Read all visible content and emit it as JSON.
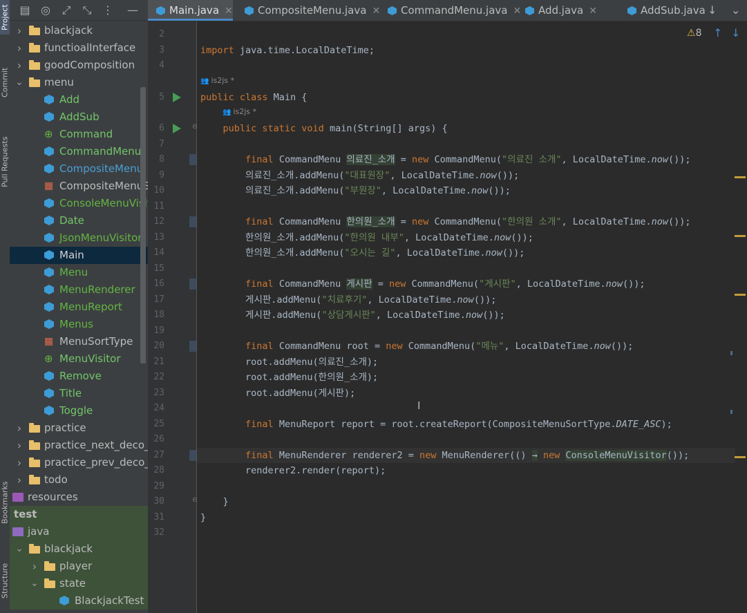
{
  "sidebar": {
    "tabs": [
      {
        "label": "Project",
        "active": true
      },
      {
        "label": "Commit",
        "active": false
      },
      {
        "label": "Pull Requests",
        "active": false
      },
      {
        "label": "Bookmarks",
        "active": false
      },
      {
        "label": "Structure",
        "active": false
      }
    ]
  },
  "project": {
    "toolbar_icons": [
      "project-files-icon",
      "target-icon",
      "expand-icon",
      "collapse-icon",
      "options-icon",
      "minimize-icon"
    ],
    "tree": [
      {
        "label": "blackjack",
        "type": "folder",
        "depth": 0,
        "expanded": false
      },
      {
        "label": "functioalInterface",
        "type": "folder",
        "depth": 0,
        "expanded": false
      },
      {
        "label": "goodComposition",
        "type": "folder",
        "depth": 0,
        "expanded": false
      },
      {
        "label": "menu",
        "type": "folder",
        "depth": 0,
        "expanded": true
      },
      {
        "label": "Add",
        "type": "class",
        "depth": 1
      },
      {
        "label": "AddSub",
        "type": "class",
        "depth": 1
      },
      {
        "label": "Command",
        "type": "interface",
        "depth": 1
      },
      {
        "label": "CommandMenu",
        "type": "class",
        "depth": 1
      },
      {
        "label": "CompositeMenu",
        "type": "class",
        "depth": 1
      },
      {
        "label": "CompositeMenuSo",
        "type": "enum",
        "depth": 1
      },
      {
        "label": "ConsoleMenuVisito",
        "type": "class",
        "depth": 1
      },
      {
        "label": "Date",
        "type": "class",
        "depth": 1
      },
      {
        "label": "JsonMenuVisitor",
        "type": "class",
        "depth": 1
      },
      {
        "label": "Main",
        "type": "class",
        "depth": 1,
        "selected": true
      },
      {
        "label": "Menu",
        "type": "class",
        "depth": 1
      },
      {
        "label": "MenuRenderer",
        "type": "class",
        "depth": 1
      },
      {
        "label": "MenuReport",
        "type": "class",
        "depth": 1
      },
      {
        "label": "Menus",
        "type": "class",
        "depth": 1
      },
      {
        "label": "MenuSortType",
        "type": "enum",
        "depth": 1
      },
      {
        "label": "MenuVisitor",
        "type": "interface",
        "depth": 1
      },
      {
        "label": "Remove",
        "type": "class",
        "depth": 1
      },
      {
        "label": "Title",
        "type": "class",
        "depth": 1
      },
      {
        "label": "Toggle",
        "type": "class",
        "depth": 1
      },
      {
        "label": "practice",
        "type": "folder",
        "depth": 0,
        "expanded": false
      },
      {
        "label": "practice_next_deco_fo",
        "type": "folder",
        "depth": 0,
        "expanded": false
      },
      {
        "label": "practice_prev_deco_fo",
        "type": "folder",
        "depth": 0,
        "expanded": false
      },
      {
        "label": "todo",
        "type": "folder",
        "depth": 0,
        "expanded": false
      },
      {
        "label": "resources",
        "type": "resources",
        "depth": -1
      },
      {
        "label": "test",
        "type": "heading",
        "depth": -2
      },
      {
        "label": "java",
        "type": "javasrc",
        "depth": -1
      },
      {
        "label": "blackjack",
        "type": "folder",
        "depth": 0,
        "expanded": true
      },
      {
        "label": "player",
        "type": "folder",
        "depth": 1,
        "expanded": false
      },
      {
        "label": "state",
        "type": "folder",
        "depth": 1,
        "expanded": true
      },
      {
        "label": "BlackjackTest",
        "type": "class",
        "depth": 2
      }
    ]
  },
  "tabs": [
    {
      "label": "Main.java",
      "active": true,
      "closable": true
    },
    {
      "label": "CompositeMenu.java",
      "active": false,
      "closable": true
    },
    {
      "label": "CommandMenu.java",
      "active": false,
      "closable": true
    },
    {
      "label": "Add.java",
      "active": false,
      "closable": true
    },
    {
      "label": "AddSub.java",
      "active": false,
      "closable": true
    }
  ],
  "inspections": {
    "warnings": "8"
  },
  "editor": {
    "current_line": 27,
    "hints": [
      {
        "before_line": 5,
        "text": "is2js *"
      },
      {
        "before_line": 6,
        "text": "is2js *"
      }
    ],
    "run_lines": [
      5,
      6
    ],
    "lines": [
      {
        "n": 2,
        "segments": []
      },
      {
        "n": 3,
        "segments": [
          [
            "kw",
            "import "
          ],
          [
            "pl",
            "java.time.LocalDateTime;"
          ]
        ]
      },
      {
        "n": 4,
        "segments": []
      },
      {
        "n": 5,
        "segments": [
          [
            "kw",
            "public class "
          ],
          [
            "pl",
            "Main {"
          ]
        ]
      },
      {
        "n": 6,
        "segments": [
          [
            "pl",
            "    "
          ],
          [
            "kw",
            "public static void "
          ],
          [
            "pl",
            "main(String[] args) {"
          ]
        ]
      },
      {
        "n": 7,
        "segments": []
      },
      {
        "n": 8,
        "segments": [
          [
            "pl",
            "        "
          ],
          [
            "kw",
            "final "
          ],
          [
            "pl",
            "CommandMenu "
          ],
          [
            "var",
            "의료진_소개"
          ],
          [
            "pl",
            " = "
          ],
          [
            "kw",
            "new "
          ],
          [
            "pl",
            "CommandMenu("
          ],
          [
            "str",
            "\"의료진 소개\""
          ],
          [
            "pl",
            ", LocalDateTime."
          ],
          [
            "it",
            "now"
          ],
          [
            "pl",
            "());"
          ]
        ]
      },
      {
        "n": 9,
        "segments": [
          [
            "pl",
            "        의료진_소개.addMenu("
          ],
          [
            "str",
            "\"대표원장\""
          ],
          [
            "pl",
            ", LocalDateTime."
          ],
          [
            "it",
            "now"
          ],
          [
            "pl",
            "());"
          ]
        ]
      },
      {
        "n": 10,
        "segments": [
          [
            "pl",
            "        의료진_소개.addMenu("
          ],
          [
            "str",
            "\"부원장\""
          ],
          [
            "pl",
            ", LocalDateTime."
          ],
          [
            "it",
            "now"
          ],
          [
            "pl",
            "());"
          ]
        ]
      },
      {
        "n": 11,
        "segments": []
      },
      {
        "n": 12,
        "segments": [
          [
            "pl",
            "        "
          ],
          [
            "kw",
            "final "
          ],
          [
            "pl",
            "CommandMenu "
          ],
          [
            "var",
            "한의원_소개"
          ],
          [
            "pl",
            " = "
          ],
          [
            "kw",
            "new "
          ],
          [
            "pl",
            "CommandMenu("
          ],
          [
            "str",
            "\"한의원 소개\""
          ],
          [
            "pl",
            ", LocalDateTime."
          ],
          [
            "it",
            "now"
          ],
          [
            "pl",
            "());"
          ]
        ]
      },
      {
        "n": 13,
        "segments": [
          [
            "pl",
            "        한의원_소개.addMenu("
          ],
          [
            "str",
            "\"한의원 내부\""
          ],
          [
            "pl",
            ", LocalDateTime."
          ],
          [
            "it",
            "now"
          ],
          [
            "pl",
            "());"
          ]
        ]
      },
      {
        "n": 14,
        "segments": [
          [
            "pl",
            "        한의원_소개.addMenu("
          ],
          [
            "str",
            "\"오시는 길\""
          ],
          [
            "pl",
            ", LocalDateTime."
          ],
          [
            "it",
            "now"
          ],
          [
            "pl",
            "());"
          ]
        ]
      },
      {
        "n": 15,
        "segments": []
      },
      {
        "n": 16,
        "segments": [
          [
            "pl",
            "        "
          ],
          [
            "kw",
            "final "
          ],
          [
            "pl",
            "CommandMenu "
          ],
          [
            "var",
            "게시판"
          ],
          [
            "pl",
            " = "
          ],
          [
            "kw",
            "new "
          ],
          [
            "pl",
            "CommandMenu("
          ],
          [
            "str",
            "\"게시판\""
          ],
          [
            "pl",
            ", LocalDateTime."
          ],
          [
            "it",
            "now"
          ],
          [
            "pl",
            "());"
          ]
        ]
      },
      {
        "n": 17,
        "segments": [
          [
            "pl",
            "        게시판.addMenu("
          ],
          [
            "str",
            "\"치료후기\""
          ],
          [
            "pl",
            ", LocalDateTime."
          ],
          [
            "it",
            "now"
          ],
          [
            "pl",
            "());"
          ]
        ]
      },
      {
        "n": 18,
        "segments": [
          [
            "pl",
            "        게시판.addMenu("
          ],
          [
            "str",
            "\"상담게시판\""
          ],
          [
            "pl",
            ", LocalDateTime."
          ],
          [
            "it",
            "now"
          ],
          [
            "pl",
            "());"
          ]
        ]
      },
      {
        "n": 19,
        "segments": []
      },
      {
        "n": 20,
        "segments": [
          [
            "pl",
            "        "
          ],
          [
            "kw",
            "final "
          ],
          [
            "pl",
            "CommandMenu root = "
          ],
          [
            "kw",
            "new "
          ],
          [
            "pl",
            "CommandMenu("
          ],
          [
            "str",
            "\"메뉴\""
          ],
          [
            "pl",
            ", LocalDateTime."
          ],
          [
            "it",
            "now"
          ],
          [
            "pl",
            "());"
          ]
        ]
      },
      {
        "n": 21,
        "segments": [
          [
            "pl",
            "        root.addMenu(의료진_소개);"
          ]
        ]
      },
      {
        "n": 22,
        "segments": [
          [
            "pl",
            "        root.addMenu(한의원_소개);"
          ]
        ]
      },
      {
        "n": 23,
        "segments": [
          [
            "pl",
            "        root.addMenu(게시판);"
          ]
        ]
      },
      {
        "n": 24,
        "segments": []
      },
      {
        "n": 25,
        "segments": [
          [
            "pl",
            "        "
          ],
          [
            "kw",
            "final "
          ],
          [
            "pl",
            "MenuReport report = root.createReport(CompositeMenuSortType."
          ],
          [
            "it",
            "DATE_ASC"
          ],
          [
            "pl",
            ");"
          ]
        ]
      },
      {
        "n": 26,
        "segments": []
      },
      {
        "n": 27,
        "segments": [
          [
            "pl",
            "        "
          ],
          [
            "kw",
            "final "
          ],
          [
            "pl",
            "MenuRenderer renderer2 = "
          ],
          [
            "kw",
            "new "
          ],
          [
            "pl",
            "MenuRenderer(() "
          ],
          [
            "var",
            "→"
          ],
          [
            "pl",
            " "
          ],
          [
            "kw",
            "new "
          ],
          [
            "var",
            "ConsoleMenuVisitor"
          ],
          [
            "pl",
            "());"
          ]
        ]
      },
      {
        "n": 28,
        "segments": [
          [
            "pl",
            "        renderer2.render(report);"
          ]
        ]
      },
      {
        "n": 29,
        "segments": []
      },
      {
        "n": 30,
        "segments": [
          [
            "pl",
            "    }"
          ]
        ]
      },
      {
        "n": 31,
        "segments": [
          [
            "pl",
            "}"
          ]
        ]
      },
      {
        "n": 32,
        "segments": []
      }
    ]
  },
  "colors": {
    "keyword": "#cc7832",
    "string": "#6a8759",
    "text": "#a9b7c6",
    "selection": "#0d293e"
  }
}
